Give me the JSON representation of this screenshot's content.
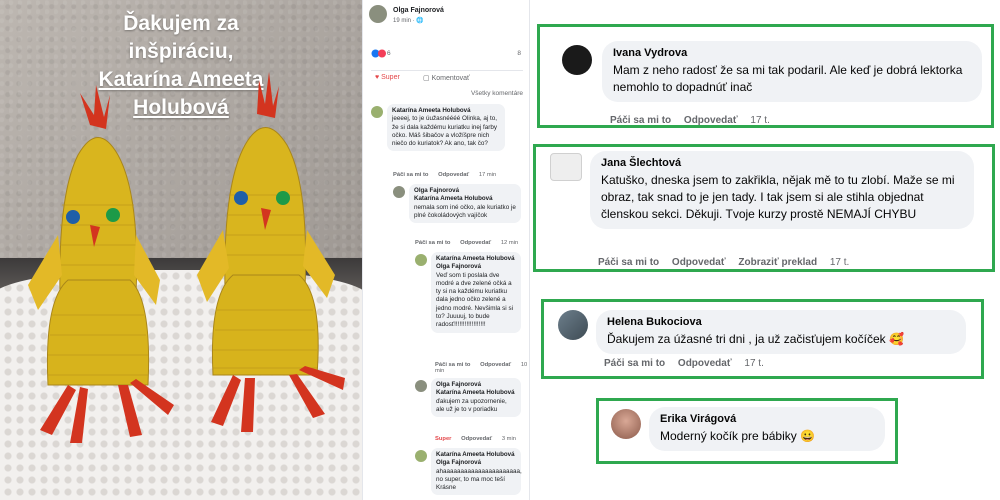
{
  "photo": {
    "caption_line1": "Ďakujem za",
    "caption_line2": "inšpiráciu,",
    "caption_name1": "Katarína Ameeta",
    "caption_name2": "Holubová"
  },
  "feed": {
    "author": "Olga Fajnorová",
    "time": "19 min · ",
    "reaction_count": "6",
    "share_count": "8",
    "actions": {
      "super": "Super",
      "comment": "Komentovať"
    },
    "sort_label": "Všetky komentáre",
    "comments": [
      {
        "author": "Katarína Ameeta Holubová",
        "text": "jeeeej, to je úužasnéééé Olinka, aj to, že si dala každému kuriatku inej farby očko. Máš šibačov a vložíšpre nich niečo do kuriatok? Ak ano, tak čo?",
        "like": "Páči sa mi to",
        "reply": "Odpovedať",
        "time": "17 min"
      },
      {
        "author": "Olga Fajnorová",
        "mention": "Katarína Ameeta Holubová",
        "text": "nemala som iné očko, ale kuriatko je plné čokoládových vajíčok",
        "like": "Páči sa mi to",
        "reply": "Odpovedať",
        "time": "12 min"
      },
      {
        "author": "Katarína Ameeta Holubová",
        "mention": "Olga Fajnorová",
        "text": "Veď som ti poslala dve modré a dve zelené očká a ty si na každému kuriatku dala jedno očko zelené a jedno modré. Nevšimla si si to? Juuuuj, to bude radosť!!!!!!!!!!!!!!!!!!",
        "like": "Páči sa mi to",
        "reply": "Odpovedať",
        "time": "10 min"
      },
      {
        "author": "Olga Fajnorová",
        "mention": "Katarína Ameeta Holubová",
        "text": "ďakujem za upozornenie, ale už je to v poriadku",
        "like": "Super",
        "reply": "Odpovedať",
        "time": "3 min"
      },
      {
        "author": "Katarína Ameeta Holubová",
        "mention": "Olga Fajnorová",
        "text": "ahaaaaaaaaaaaaaaaaaaaaaa, no super, to ma moc teší Krásne",
        "like": "",
        "reply": "",
        "time": ""
      }
    ]
  },
  "comments": [
    {
      "name": "Ivana Vydrova",
      "text": "Mam z neho radosť že sa mi tak podaril. Ale keď je dobrá lektorka nemohlo to dopadnúť inač",
      "like": "Páči sa mi to",
      "reply": "Odpovedať",
      "extra": "",
      "time": "17 t."
    },
    {
      "name": "Jana Šlechtová",
      "text": "Katuško, dneska jsem to zakřikla, nějak mě to tu zlobí. Maže se mi obraz, tak snad to je jen tady. I tak jsem si ale stihla objednat členskou sekci. Děkuji. Tvoje kurzy prostě NEMAJÍ CHYBU",
      "like": "Páči sa mi to",
      "reply": "Odpovedať",
      "extra": "Zobraziť preklad",
      "time": "17 t."
    },
    {
      "name": "Helena Bukociova",
      "text": "Ďakujem za úžasné tri dni , ja už začisťujem kočíček",
      "like": "Páči sa mi to",
      "reply": "Odpovedať",
      "extra": "",
      "time": "17 t."
    },
    {
      "name": "Erika Virágová",
      "text": "Moderný kočík pre bábiky",
      "like": "",
      "reply": "",
      "extra": "",
      "time": ""
    }
  ],
  "colors": {
    "highlight_border": "#2fa84f",
    "bubble_bg": "#f0f2f5",
    "meta_text": "#65676b",
    "like_red": "#e4474a"
  }
}
